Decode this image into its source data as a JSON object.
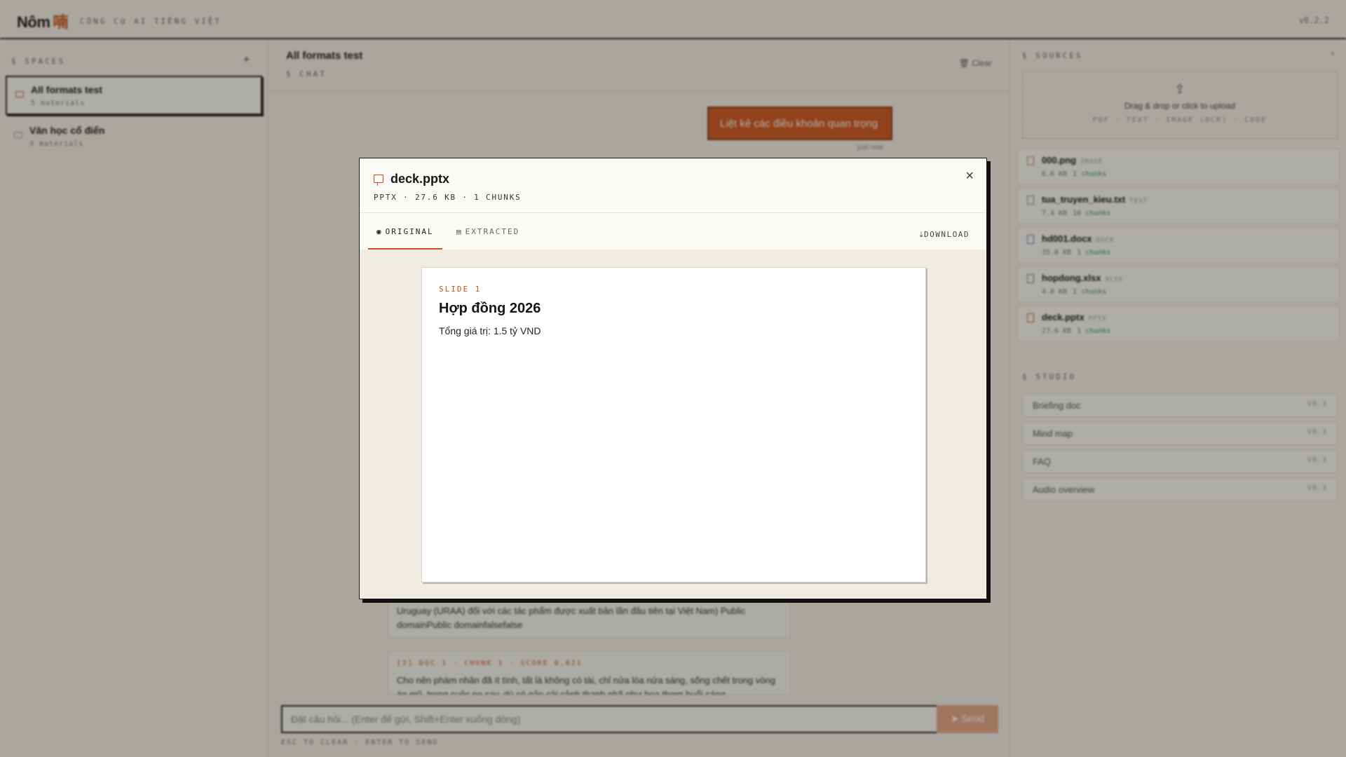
{
  "app": {
    "brand": "Nôm",
    "brand_glyph": "喃",
    "tagline": "CÔNG CỤ AI TIẾNG VIỆT",
    "version": "v0.2.2"
  },
  "spaces": {
    "header": "§ SPACES",
    "add_label": "+",
    "items": [
      {
        "name": "All formats test",
        "meta": "5 materials",
        "active": true
      },
      {
        "name": "Văn học cổ điển",
        "meta": "3 materials",
        "active": false
      }
    ]
  },
  "chat": {
    "title": "All formats test",
    "subtitle": "§ CHAT",
    "clear_label": "Clear",
    "user_message": "Liệt kê các điều khoản quan trọng",
    "message_time": "just now",
    "citations": [
      {
        "label": "",
        "text": "Uruguay (URAA) đối với các tác phẩm được xuất bản lần đầu tiên tại Việt Nam) Public domainPublic domainfalsefalse"
      },
      {
        "label": "[2] DOC 1 · CHUNK 1 · SCORE 0.021",
        "text": "Cho nên phàm nhân đã ít tình, tất là không có tài, chỉ nửa lòa nửa sáng, sống chết trong vòng áo mũ, trong cuộc no say, dù có gặp cái cảnh thanh nhã như hoa thơm buổi sáng,"
      }
    ],
    "composer_placeholder": "Đặt câu hỏi... (Enter để gửi, Shift+Enter xuống dòng)",
    "send_label": "Send",
    "hint": "ESC TO CLEAR · ENTER TO SEND"
  },
  "sources": {
    "header": "§ SOURCES",
    "upload_text": "Drag & drop or click to upload",
    "upload_formats": "PDF · TEXT · IMAGE (OCR) · CODE",
    "items": [
      {
        "name": "000.png",
        "type": "IMAGE",
        "size": "6.6 KB",
        "chunks": "1 chunks",
        "color": "#c9785a"
      },
      {
        "name": "tua_truyen_kieu.txt",
        "type": "TEXT",
        "size": "7.4 KB",
        "chunks": "10 chunks",
        "color": "#5e9a6e"
      },
      {
        "name": "hd001.docx",
        "type": "DOCX",
        "size": "35.8 KB",
        "chunks": "1 chunks",
        "color": "#5b6fb5"
      },
      {
        "name": "hopdong.xlsx",
        "type": "XLSX",
        "size": "4.8 KB",
        "chunks": "1 chunks",
        "color": "#4f9360"
      },
      {
        "name": "deck.pptx",
        "type": "PPTX",
        "size": "27.6 KB",
        "chunks": "1 chunks",
        "color": "#c9521f"
      }
    ]
  },
  "studio": {
    "header": "§ STUDIO",
    "items": [
      {
        "label": "Briefing doc",
        "badge": "V0.3"
      },
      {
        "label": "Mind map",
        "badge": "V0.3"
      },
      {
        "label": "FAQ",
        "badge": "V0.3"
      },
      {
        "label": "Audio overview",
        "badge": "V0.3"
      }
    ]
  },
  "modal": {
    "title": "deck.pptx",
    "meta": "PPTX · 27.6 KB · 1 CHUNKS",
    "close_label": "×",
    "tabs": [
      {
        "label": "ORIGINAL",
        "icon": "eye-icon",
        "active": true
      },
      {
        "label": "EXTRACTED",
        "icon": "document-icon",
        "active": false
      }
    ],
    "download_label": "DOWNLOAD",
    "slide": {
      "label": "SLIDE 1",
      "title": "Hợp đồng 2026",
      "body": "Tổng giá trị: 1.5 tỷ VND"
    }
  },
  "colors": {
    "accent": "#c9521f",
    "background": "#f2efe8",
    "ink": "#1a1a1a"
  }
}
